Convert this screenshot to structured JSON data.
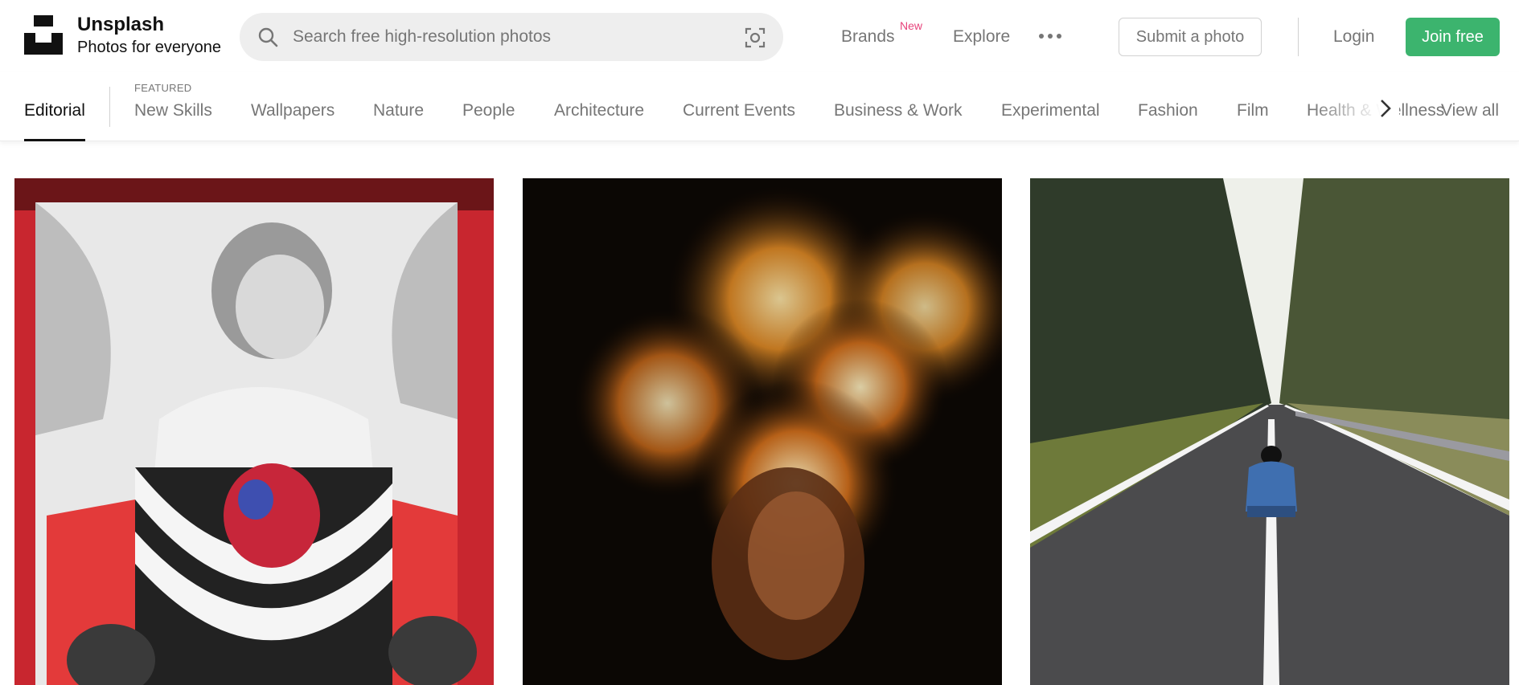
{
  "header": {
    "brand_name": "Unsplash",
    "brand_tagline": "Photos for everyone",
    "search_placeholder": "Search free high-resolution photos",
    "nav": {
      "brands": "Brands",
      "brands_badge": "New",
      "explore": "Explore"
    },
    "submit_label": "Submit a photo",
    "login_label": "Login",
    "join_label": "Join free",
    "icons": {
      "logo": "unsplash-logo",
      "search": "search-icon",
      "visual_search": "visual-search-icon",
      "more": "more-dots-icon"
    }
  },
  "topics": {
    "featured_label": "FEATURED",
    "active": "Editorial",
    "items": [
      "New Skills",
      "Wallpapers",
      "Nature",
      "People",
      "Architecture",
      "Current Events",
      "Business & Work",
      "Experimental",
      "Fashion",
      "Film",
      "Health & Wellness"
    ],
    "view_all": "View all"
  },
  "colors": {
    "accent_join": "#3cb46e",
    "badge_new": "#e7437b",
    "muted_text": "#767676"
  }
}
